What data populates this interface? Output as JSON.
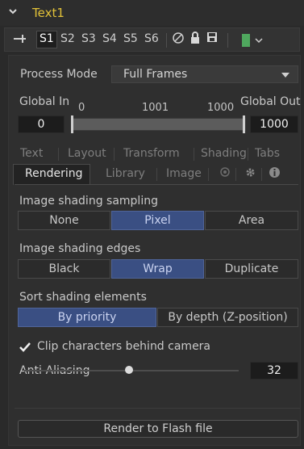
{
  "header": {
    "tool_name": "Text1"
  },
  "toolbar": {
    "slots": [
      "S1",
      "S2",
      "S3",
      "S4",
      "S5",
      "S6"
    ],
    "selected_slot": "S1"
  },
  "process": {
    "label": "Process Mode",
    "value": "Full Frames"
  },
  "range": {
    "global_in_label": "Global In",
    "global_out_label": "Global Out",
    "tick_left": "0",
    "tick_mid": "1001",
    "tick_right": "1000",
    "in_value": "0",
    "out_value": "1000"
  },
  "tabs": {
    "row1": [
      "Text",
      "Layout",
      "Transform",
      "Shading",
      "Tabs"
    ],
    "active": "Rendering",
    "row2": [
      "Library",
      "Image"
    ]
  },
  "sampling": {
    "label": "Image shading sampling",
    "options": [
      "None",
      "Pixel",
      "Area"
    ],
    "selected": "Pixel"
  },
  "edges": {
    "label": "Image shading edges",
    "options": [
      "Black",
      "Wrap",
      "Duplicate"
    ],
    "selected": "Wrap"
  },
  "sort": {
    "label": "Sort shading elements",
    "options": [
      "By priority",
      "By depth (Z-position)"
    ],
    "selected": "By priority"
  },
  "clip": {
    "label": "Clip characters behind camera",
    "checked": true
  },
  "antialias": {
    "label": "Anti-Aliasing",
    "value": "32",
    "level_fraction": 0.5
  },
  "actions": {
    "render_label": "Render to Flash file"
  },
  "colors": {
    "accent": "#3a4f83",
    "title": "#e0c038",
    "swatch": "#4fa85e"
  }
}
